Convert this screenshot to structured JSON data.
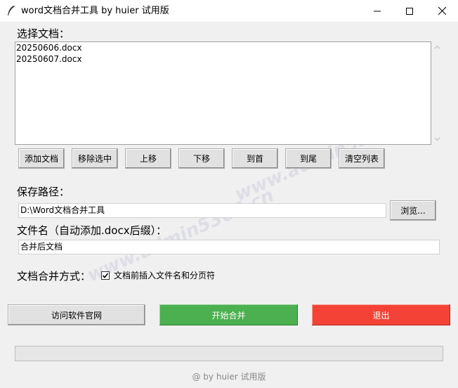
{
  "window": {
    "title": "word文档合并工具 by huier 试用版",
    "icons": {
      "app": "feather-icon",
      "minimize": "minimize-icon",
      "maximize": "maximize-icon",
      "close": "close-icon"
    }
  },
  "file_list": {
    "label": "选择文档：",
    "items": [
      "20250606.docx",
      "20250607.docx"
    ],
    "scroll_icons": [
      "chevron-up-icon",
      "chevron-down-icon"
    ]
  },
  "toolbar": {
    "add": "添加文档",
    "remove": "移除选中",
    "up": "上移",
    "down": "下移",
    "top": "到首",
    "bottom": "到尾",
    "clear": "清空列表"
  },
  "save_path": {
    "label": "保存路径：",
    "value": "D:\\Word文档合并工具",
    "browse": "浏览..."
  },
  "filename": {
    "label": "文件名（自动添加.docx后缀）：",
    "value": "合并后文档"
  },
  "merge_mode": {
    "label": "文档合并方式：",
    "checkbox_label": "文档前插入文件名和分页符",
    "checked": true
  },
  "actions": {
    "website": "访问软件官网",
    "start": "开始合并",
    "exit": "退出"
  },
  "progress": {
    "value": 0
  },
  "colors": {
    "start": "#4caf50",
    "exit": "#f44336",
    "website": "#e1e1e1"
  },
  "footer": "@ by huier 试用版",
  "watermark": "www.admin5365.cn"
}
